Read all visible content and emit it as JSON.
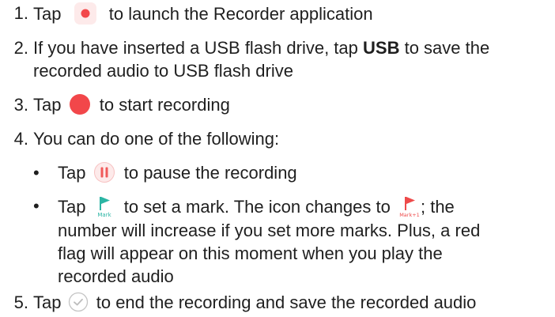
{
  "steps": [
    {
      "num": "1.",
      "before": "Tap",
      "after": "to launch the Recorder application"
    },
    {
      "num": "2.",
      "line1_before": "If you have inserted a USB flash drive, tap",
      "bold": "USB",
      "line1_after": "to save the",
      "line2": "recorded audio to USB flash drive"
    },
    {
      "num": "3.",
      "before": "Tap",
      "after": "to start recording"
    },
    {
      "num": "4.",
      "text": "You can do one of the following:"
    },
    {
      "num": "5.",
      "before": "Tap",
      "after": "to end the recording and save the recorded audio"
    }
  ],
  "bullets": [
    {
      "symbol": "•",
      "before": "Tap",
      "after": "to pause the recording"
    },
    {
      "symbol": "•",
      "before": "Tap",
      "middle": "to set a mark. The icon changes to",
      "after": "; the",
      "line2": "number will increase if you set more marks. Plus, a red",
      "line3": "flag will appear on this moment when you play the",
      "line4": "recorded audio"
    }
  ],
  "icons": {
    "recorder_app": "recorder-app-icon",
    "record": "record-button-icon",
    "pause": "pause-icon",
    "mark": "mark-flag-icon",
    "mark_plus": "mark-plus-one-flag-icon",
    "done": "checkmark-icon",
    "mark_label": "Mark",
    "mark_plus_label": "Mark+1"
  },
  "colors": {
    "text": "#1f1f1f",
    "record_red": "#f2474a",
    "flag_teal": "#2bb5a4",
    "flag_red": "#ee4a4a",
    "pause_red": "#f05a5a",
    "check_gray": "#c4c4c4"
  }
}
